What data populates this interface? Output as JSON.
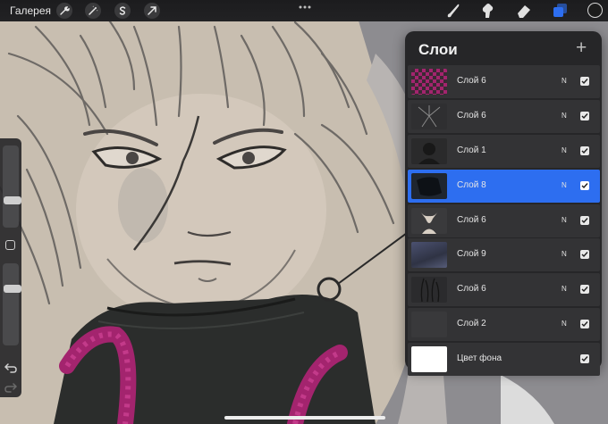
{
  "toolbar": {
    "gallery_label": "Галерея",
    "left_icons": [
      "wrench-icon",
      "magic-wand-icon",
      "selection-icon",
      "transform-arrow-icon"
    ],
    "right_icons": [
      "brush-icon",
      "smudge-icon",
      "eraser-icon",
      "layers-icon"
    ],
    "active_color": "#1c1c1c"
  },
  "layers_panel": {
    "title": "Слои",
    "add_symbol": "+",
    "layers": [
      {
        "name": "Слой 6",
        "blend": "N",
        "visible": true,
        "active": false,
        "thumb": "checker"
      },
      {
        "name": "Слой 6",
        "blend": "N",
        "visible": true,
        "active": false,
        "thumb": "lines"
      },
      {
        "name": "Слой 1",
        "blend": "N",
        "visible": true,
        "active": false,
        "thumb": "dark-figure"
      },
      {
        "name": "Слой 8",
        "blend": "N",
        "visible": true,
        "active": true,
        "thumb": "dark-shape"
      },
      {
        "name": "Слой 6",
        "blend": "N",
        "visible": true,
        "active": false,
        "thumb": "face"
      },
      {
        "name": "Слой 9",
        "blend": "N",
        "visible": true,
        "active": false,
        "thumb": "blue-texture"
      },
      {
        "name": "Слой 6",
        "blend": "N",
        "visible": true,
        "active": false,
        "thumb": "strands"
      },
      {
        "name": "Слой 2",
        "blend": "N",
        "visible": true,
        "active": false,
        "thumb": "dark-fill"
      },
      {
        "name": "Цвет фона",
        "blend": "",
        "visible": true,
        "active": false,
        "thumb": "white"
      }
    ]
  },
  "colors": {
    "accent": "#2d6ef0",
    "panel_bg": "#262628",
    "canvas_bg": "#c9bfb2"
  }
}
